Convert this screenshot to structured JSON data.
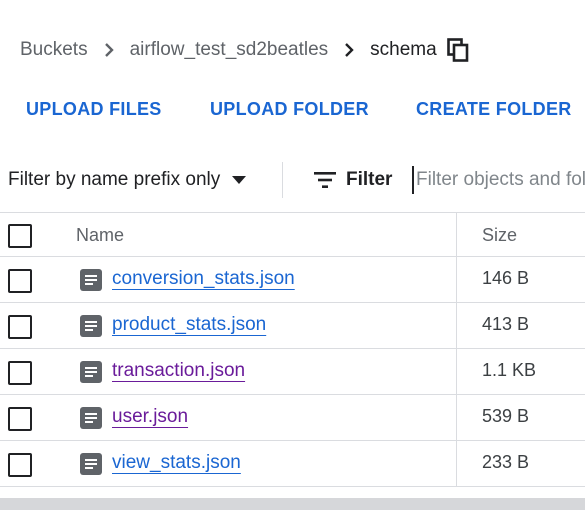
{
  "breadcrumb": {
    "items": [
      "Buckets",
      "airflow_test_sd2beatles"
    ],
    "current": "schema"
  },
  "actions": {
    "upload_files": "UPLOAD FILES",
    "upload_folder": "UPLOAD FOLDER",
    "create_folder": "CREATE FOLDER"
  },
  "filter": {
    "prefix_option": "Filter by name prefix only",
    "filter_label": "Filter",
    "placeholder": "Filter objects and folders"
  },
  "table": {
    "headers": {
      "name": "Name",
      "size": "Size"
    },
    "rows": [
      {
        "name": "conversion_stats.json",
        "size": "146 B",
        "visited": false
      },
      {
        "name": "product_stats.json",
        "size": "413 B",
        "visited": false
      },
      {
        "name": "transaction.json",
        "size": "1.1 KB",
        "visited": true
      },
      {
        "name": "user.json",
        "size": "539 B",
        "visited": true
      },
      {
        "name": "view_stats.json",
        "size": "233 B",
        "visited": false
      }
    ]
  },
  "colors": {
    "link": "#1a66d2",
    "visited_link": "#6a1b9a",
    "icon_gray": "#5f6368",
    "divider": "#dadce0"
  },
  "icons": {
    "separator": "chevron-right-icon",
    "copy": "copy-icon",
    "dropdown": "caret-down-icon",
    "filter": "filter-lines-icon",
    "file": "document-icon"
  }
}
